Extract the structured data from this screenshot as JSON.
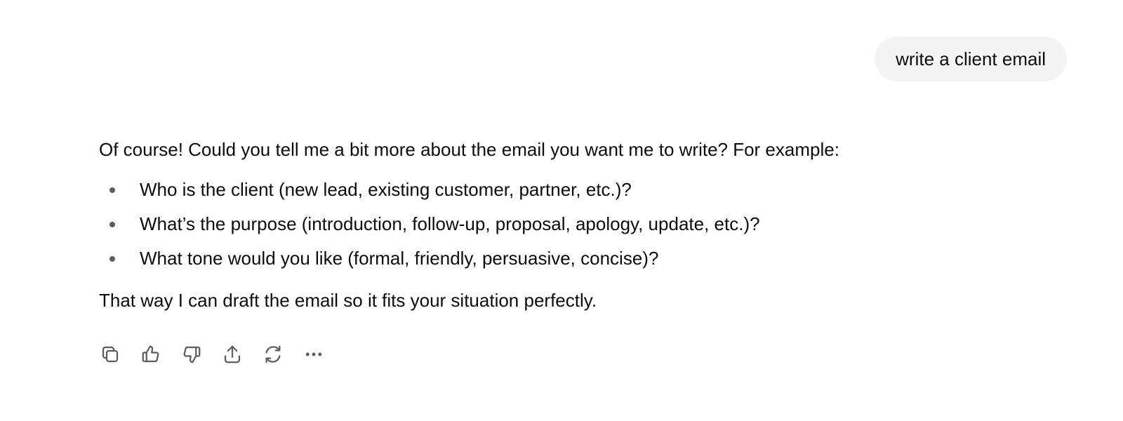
{
  "user_message": {
    "text": "write a client email"
  },
  "assistant_message": {
    "intro": "Of course! Could you tell me a bit more about the email you want me to write? For example:",
    "bullets": [
      "Who is the client (new lead, existing customer, partner, etc.)?",
      "What’s the purpose (introduction, follow-up, proposal, apology, update, etc.)?",
      "What tone would you like (formal, friendly, persuasive, concise)?"
    ],
    "outro": "That way I can draft the email so it fits your situation perfectly."
  },
  "actions": [
    {
      "icon": "copy-icon"
    },
    {
      "icon": "thumbs-up-icon"
    },
    {
      "icon": "thumbs-down-icon"
    },
    {
      "icon": "share-icon"
    },
    {
      "icon": "regenerate-icon"
    },
    {
      "icon": "more-icon"
    }
  ],
  "colors": {
    "bubble_bg": "#f4f4f4",
    "text": "#0d0d0d",
    "icon": "#5d5d5d"
  }
}
